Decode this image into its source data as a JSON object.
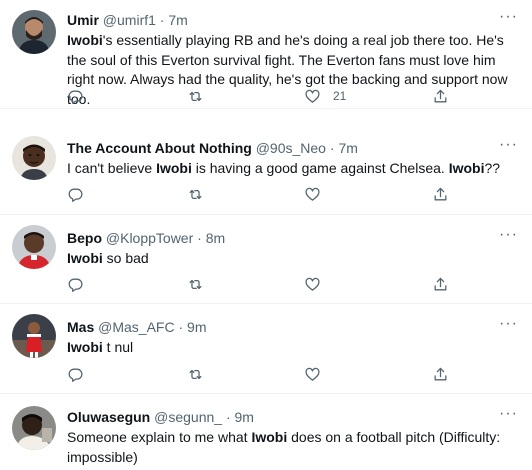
{
  "tweets": [
    {
      "name": "Umir",
      "handle": "@umirf1",
      "sep": "·",
      "time": "7m",
      "text": [
        {
          "t": "Iwobi",
          "b": true
        },
        {
          "t": "'s essentially playing RB and he's doing a real job there too. He's the soul of this Everton survival fight. The Everton fans must love him right now. Always had the quality, he's got the backing and support now too.",
          "b": false
        }
      ],
      "likes": "21"
    },
    {
      "name": "The Account About Nothing",
      "handle": "@90s_Neo",
      "sep": "·",
      "time": "7m",
      "text": [
        {
          "t": "I can't believe ",
          "b": false
        },
        {
          "t": "Iwobi",
          "b": true
        },
        {
          "t": " is having a good game against Chelsea. ",
          "b": false
        },
        {
          "t": "Iwobi",
          "b": true
        },
        {
          "t": "??",
          "b": false
        }
      ],
      "likes": ""
    },
    {
      "name": "Bepo",
      "handle": "@KloppTower",
      "sep": "·",
      "time": "8m",
      "text": [
        {
          "t": "Iwobi",
          "b": true
        },
        {
          "t": " so bad",
          "b": false
        }
      ],
      "likes": ""
    },
    {
      "name": "Mas",
      "handle": "@Mas_AFC",
      "sep": "·",
      "time": "9m",
      "text": [
        {
          "t": "Iwobi",
          "b": true
        },
        {
          "t": " t nul",
          "b": false
        }
      ],
      "likes": ""
    },
    {
      "name": "Oluwasegun",
      "handle": "@segunn_",
      "sep": "·",
      "time": "9m",
      "text": [
        {
          "t": "Someone explain to me what ",
          "b": false
        },
        {
          "t": "Iwobi",
          "b": true
        },
        {
          "t": " does on a football pitch (Difficulty: impossible)",
          "b": false
        }
      ],
      "likes": ""
    }
  ],
  "ui": {
    "more_glyph": "···",
    "icons": {
      "reply": "reply-icon",
      "retweet": "retweet-icon",
      "like": "like-icon",
      "share": "share-icon",
      "more": "more-icon"
    },
    "colors": {
      "text": "#0f1419",
      "secondary": "#536471",
      "divider": "#eff3f4"
    }
  }
}
